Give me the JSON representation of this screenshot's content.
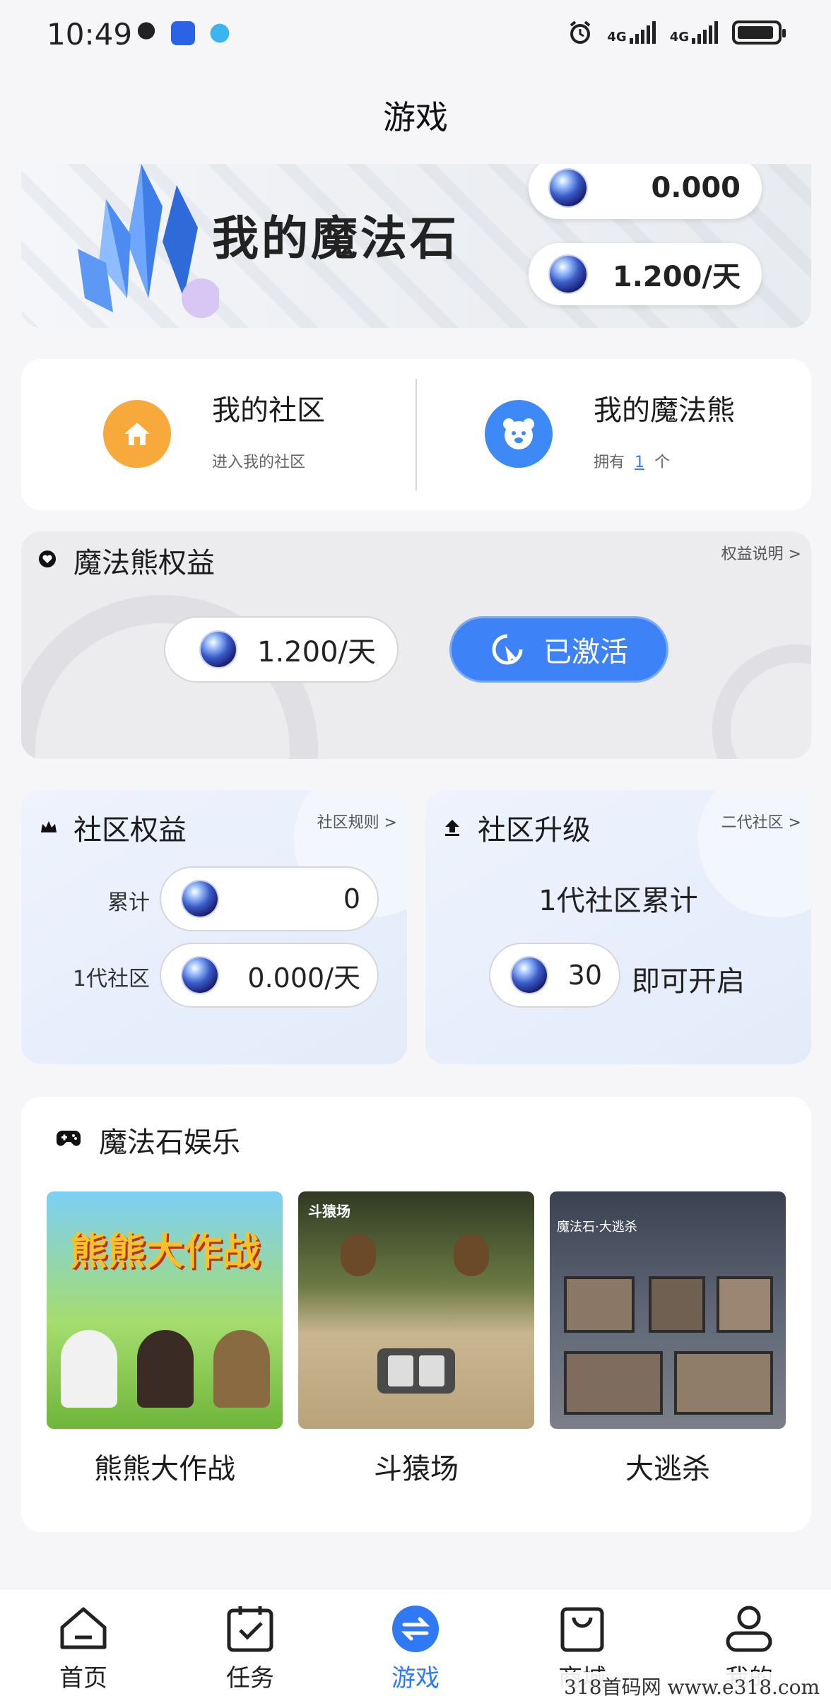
{
  "status_bar": {
    "time": "10:49",
    "network_1": "4G",
    "network_2": "4G",
    "icons": [
      "qq-icon",
      "app-shield-icon",
      "app-bird-icon",
      "alarm-icon",
      "signal-icon",
      "signal-icon",
      "battery-charging-icon"
    ]
  },
  "page_title": "游戏",
  "banner": {
    "title": "我的魔法石",
    "balance": "0.000",
    "rate": "1.200/天"
  },
  "community": {
    "my_community_title": "我的社区",
    "my_community_sub": "进入我的社区",
    "my_bear_title": "我的魔法熊",
    "owned_prefix": "拥有",
    "owned_count": "1",
    "owned_suffix": "个"
  },
  "bear_rights": {
    "title": "魔法熊权益",
    "link": "权益说明 >",
    "rate": "1.200/天",
    "activate_label": "已激活"
  },
  "community_rights": {
    "title": "社区权益",
    "link": "社区规则 >",
    "total_label": "累计",
    "total_value": "0",
    "gen1_label": "1代社区",
    "gen1_value": "0.000/天"
  },
  "community_upgrade": {
    "title": "社区升级",
    "link": "二代社区 >",
    "desc": "1代社区累计",
    "required": "30",
    "suffix": "即可开启"
  },
  "entertainment": {
    "title": "魔法石娱乐",
    "games": [
      {
        "name": "熊熊大作战",
        "tile_text": "熊熊大作战"
      },
      {
        "name": "斗猿场",
        "tile_text": "斗猿场"
      },
      {
        "name": "大逃杀",
        "tile_text": "魔法石·大逃杀"
      }
    ]
  },
  "bottom_nav": {
    "items": [
      {
        "label": "首页",
        "icon": "home-icon"
      },
      {
        "label": "任务",
        "icon": "task-icon"
      },
      {
        "label": "游戏",
        "icon": "game-swap-icon",
        "active": true
      },
      {
        "label": "商城",
        "icon": "shop-bag-icon"
      },
      {
        "label": "我的",
        "icon": "profile-icon"
      }
    ]
  },
  "watermark": "318首码网 www.e318.com",
  "colors": {
    "accent": "#3d82f6",
    "orange": "#f7a93b",
    "background": "#f6f6f8"
  }
}
